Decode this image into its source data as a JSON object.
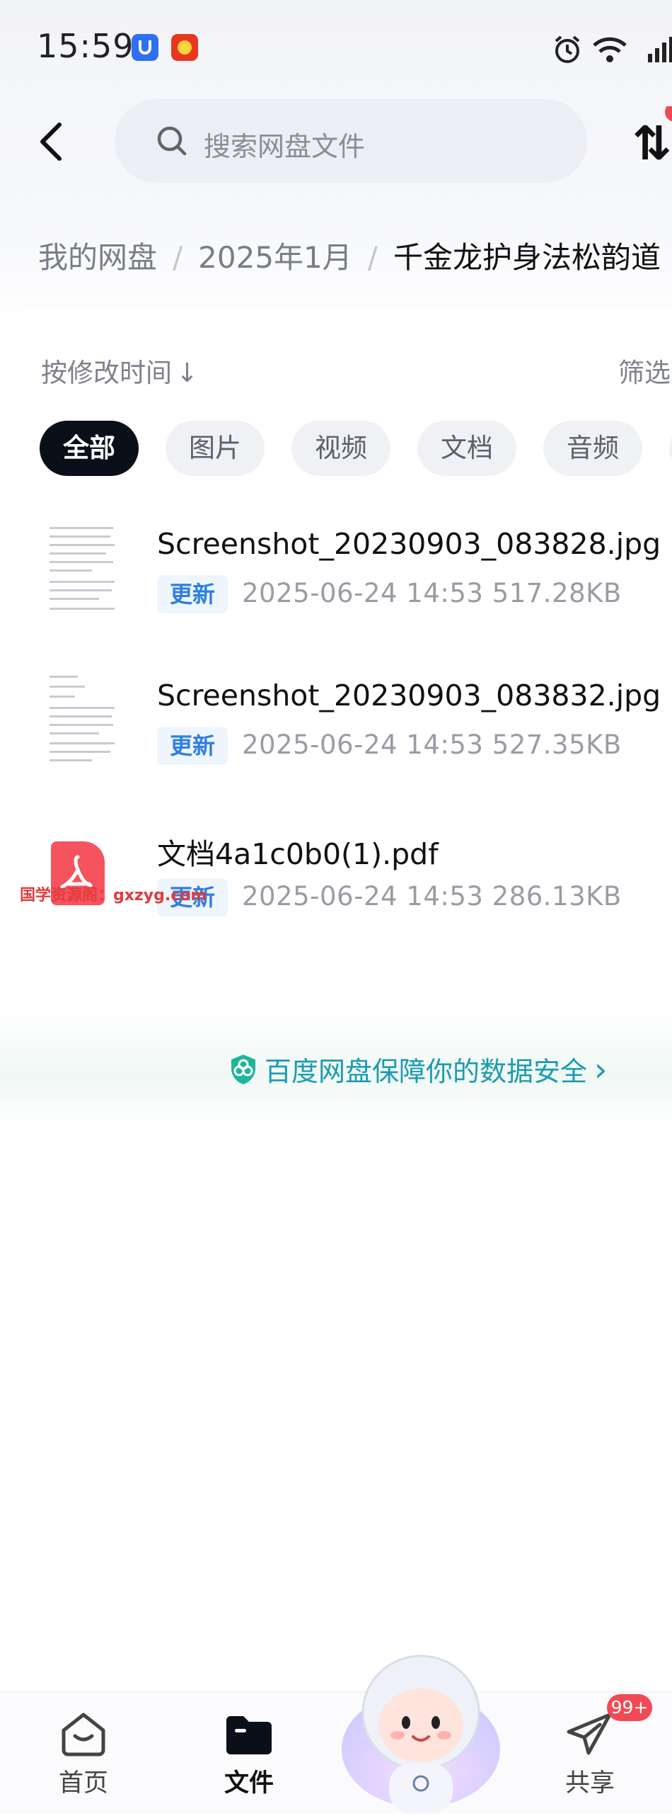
{
  "status_bar": {
    "time": "15:59"
  },
  "search": {
    "placeholder": "搜索网盘文件"
  },
  "breadcrumb": [
    "我的网盘",
    "2025年1月",
    "千金龙护身法松韵道"
  ],
  "sort": {
    "label": "按修改时间",
    "arrow": "↓"
  },
  "filter_label": "筛选",
  "chips": [
    "全部",
    "图片",
    "视频",
    "文档",
    "音频"
  ],
  "files": [
    {
      "name": "Screenshot_20230903_083828.jpg",
      "tag": "更新",
      "meta": "2025-06-24  14:53  517.28KB",
      "icon": "image-thumbnail"
    },
    {
      "name": "Screenshot_20230903_083832.jpg",
      "tag": "更新",
      "meta": "2025-06-24  14:53  527.35KB",
      "icon": "image-thumbnail"
    },
    {
      "name": "文档4a1c0b0(1).pdf",
      "tag": "更新",
      "meta": "2025-06-24  14:53  286.13KB",
      "icon": "pdf-icon"
    }
  ],
  "watermark": "国学资源阁：gxzyg.com",
  "security_banner": {
    "text": "百度网盘保障你的数据安全",
    "chevron": "›"
  },
  "bottom_nav": [
    {
      "label": "首页",
      "icon": "home-icon",
      "active": false
    },
    {
      "label": "文件",
      "icon": "folder-icon",
      "active": true
    },
    {
      "label": "共享",
      "icon": "share-plane-icon",
      "active": false
    }
  ],
  "share_badge": "99+",
  "colors": {
    "accent": "#2f7fe0",
    "chip_active": "#0b0f1a",
    "badge": "#f24a55",
    "secure_text": "#1b9bb0"
  }
}
